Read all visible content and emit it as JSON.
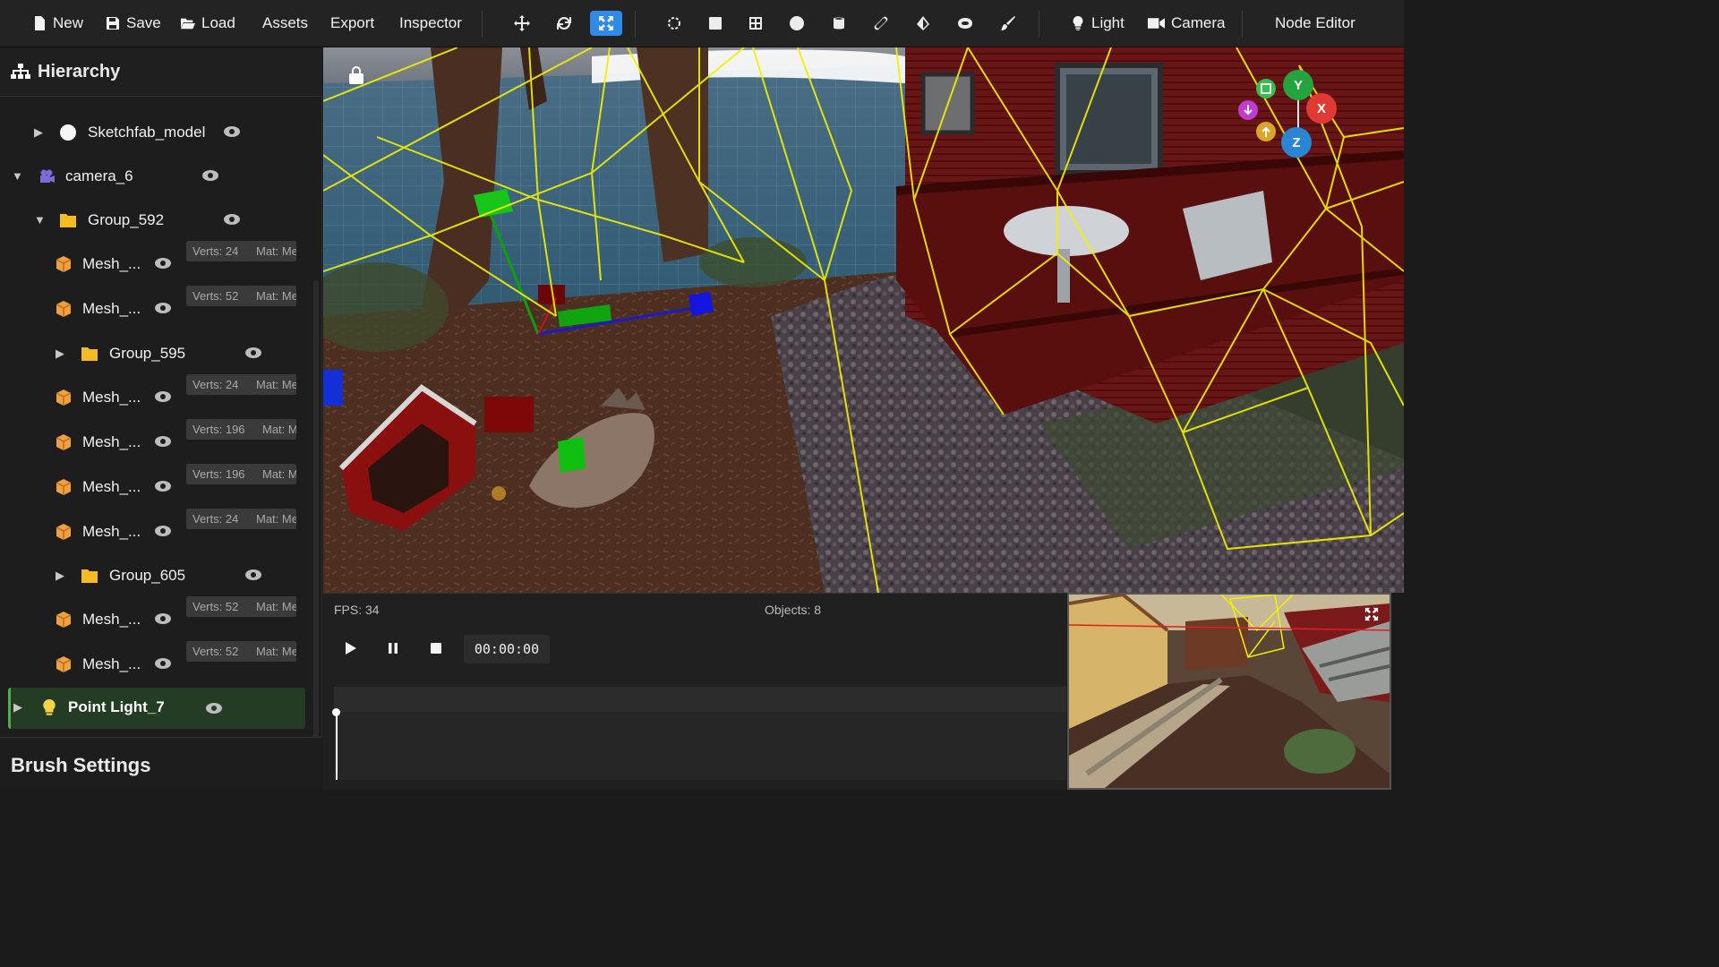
{
  "toolbar": {
    "menu": [
      {
        "label": "New",
        "icon": "file-icon"
      },
      {
        "label": "Save",
        "icon": "floppy-icon"
      },
      {
        "label": "Load",
        "icon": "folder-open-icon"
      },
      {
        "label": "Assets",
        "icon": ""
      },
      {
        "label": "Export",
        "icon": ""
      },
      {
        "label": "Inspector",
        "icon": ""
      }
    ],
    "light_label": "Light",
    "camera_label": "Camera",
    "node_editor_label": "Node Editor",
    "accent": "#2f8be6"
  },
  "hierarchy": {
    "title": "Hierarchy",
    "items": [
      {
        "label": "Sketchfab_model",
        "type": "sphere"
      },
      {
        "label": "camera_6",
        "type": "camera"
      },
      {
        "label": "Group_592",
        "type": "folder"
      },
      {
        "label": "Mesh_...",
        "type": "mesh",
        "verts": "Verts: 24",
        "mat": "Mat: Me"
      },
      {
        "label": "Mesh_...",
        "type": "mesh",
        "verts": "Verts: 52",
        "mat": "Mat: Me"
      },
      {
        "label": "Group_595",
        "type": "folder"
      },
      {
        "label": "Mesh_...",
        "type": "mesh",
        "verts": "Verts: 24",
        "mat": "Mat: Me"
      },
      {
        "label": "Mesh_...",
        "type": "mesh",
        "verts": "Verts: 196",
        "mat": "Mat: M"
      },
      {
        "label": "Mesh_...",
        "type": "mesh",
        "verts": "Verts: 196",
        "mat": "Mat: M"
      },
      {
        "label": "Mesh_...",
        "type": "mesh",
        "verts": "Verts: 24",
        "mat": "Mat: Me"
      },
      {
        "label": "Group_605",
        "type": "folder"
      },
      {
        "label": "Mesh_...",
        "type": "mesh",
        "verts": "Verts: 52",
        "mat": "Mat: Me"
      },
      {
        "label": "Mesh_...",
        "type": "mesh",
        "verts": "Verts: 52",
        "mat": "Mat: Me"
      }
    ],
    "selected": {
      "label": "Point Light_7",
      "type": "light"
    }
  },
  "brush": {
    "title": "Brush Settings"
  },
  "gizmo": {
    "x": "X",
    "y": "Y",
    "z": "Z"
  },
  "timeline": {
    "fps": "FPS: 34",
    "objects": "Objects: 8",
    "timecode": "00:00:00"
  }
}
